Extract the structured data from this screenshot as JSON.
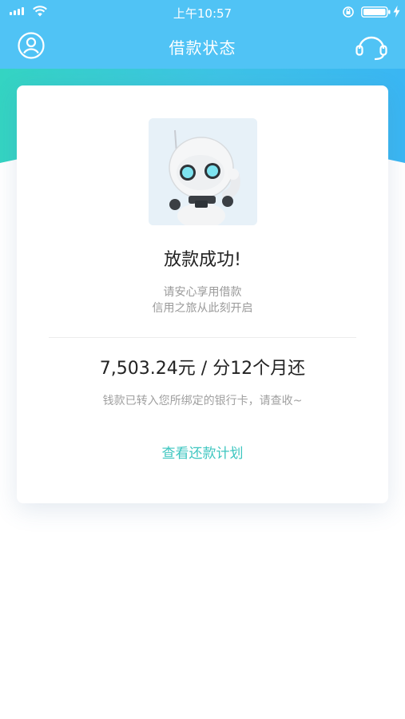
{
  "status_bar": {
    "time": "上午10:57"
  },
  "nav": {
    "title": "借款状态",
    "left_icon": "user-icon",
    "right_icon": "headset-icon"
  },
  "result": {
    "headline": "放款成功!",
    "subtitle_line1": "请安心享用借款",
    "subtitle_line2": "信用之旅从此刻开启",
    "amount": "7,503.24元",
    "separator": " / ",
    "term": "分12个月还",
    "note": "钱款已转入您所绑定的银行卡，请查收~",
    "plan_link": "查看还款计划"
  },
  "colors": {
    "primary": "#50c3f5",
    "accent_teal": "#3dc6c0",
    "text_dark": "#222222",
    "text_muted": "#9a9a9a"
  }
}
